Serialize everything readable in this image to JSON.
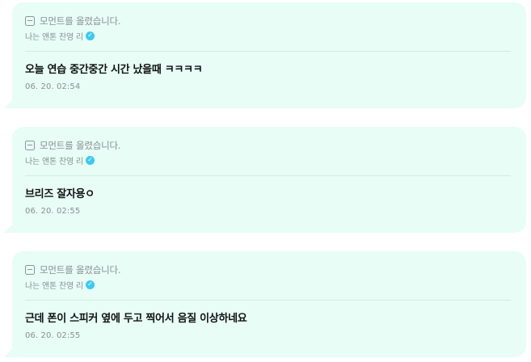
{
  "posts": [
    {
      "header": "모먼트를 올렸습니다.",
      "author": "나는 앤톤 찬영 리",
      "message": "오늘 연습 중간중간 시간 났을때 ㅋㅋㅋㅋ",
      "timestamp": "06. 20. 02:54"
    },
    {
      "header": "모먼트를 올렸습니다.",
      "author": "나는 앤톤 찬영 리",
      "message": "브리즈 잘자용ㅇ",
      "timestamp": "06. 20. 02:55"
    },
    {
      "header": "모먼트를 올렸습니다.",
      "author": "나는 앤톤 찬영 리",
      "message": "근데 폰이 스피커 옆에 두고 찍어서 음질 이상하네요",
      "timestamp": "06. 20. 02:55"
    }
  ],
  "icons": {
    "moment": "moment-post-icon",
    "verified": "verified-check-icon"
  },
  "colors": {
    "bubble_background": "#e7fdf6",
    "verified_badge": "#3ec9ee",
    "secondary_text": "#8b9091",
    "primary_text": "#111111"
  }
}
